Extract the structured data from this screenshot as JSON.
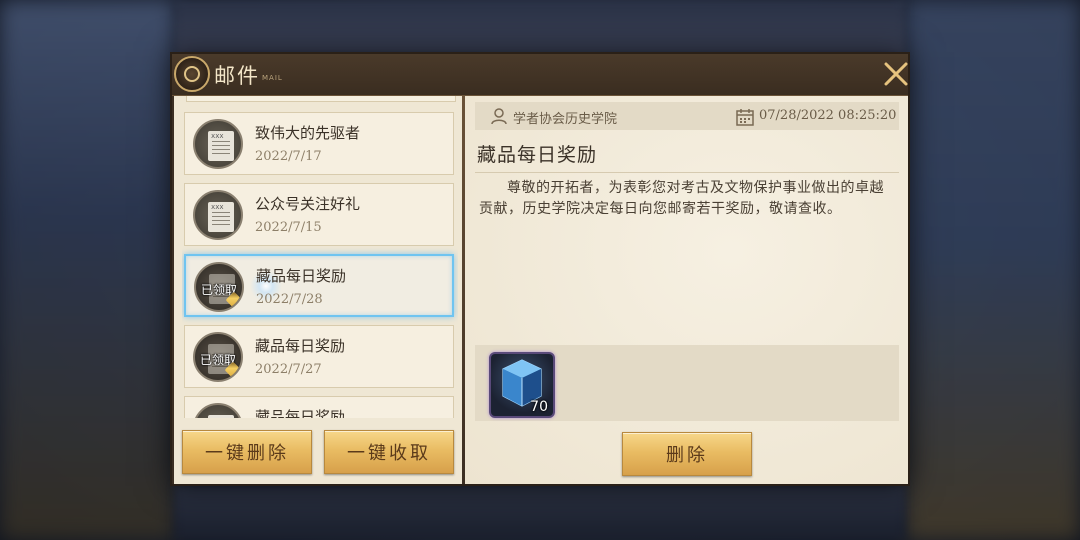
{
  "header": {
    "title": "邮件",
    "subtitle": "MAIL"
  },
  "mail_list": [
    {
      "title": "致伟大的先驱者",
      "date": "2022/7/17",
      "status": "unread-read",
      "icon": "letter-icon"
    },
    {
      "title": "公众号关注好礼",
      "date": "2022/7/15",
      "status": "read",
      "icon": "letter-icon"
    },
    {
      "title": "藏品每日奖励",
      "date": "2022/7/28",
      "status": "claimed",
      "claimed_label": "已领取",
      "selected": true,
      "icon": "letter-icon"
    },
    {
      "title": "藏品每日奖励",
      "date": "2022/7/27",
      "status": "claimed",
      "claimed_label": "已领取",
      "icon": "letter-icon"
    },
    {
      "title": "藏品每日奖励",
      "date": "",
      "status": "partial",
      "icon": "letter-icon"
    }
  ],
  "left_buttons": {
    "delete_all": "一键删除",
    "claim_all": "一键收取"
  },
  "detail": {
    "sender": "学者协会历史学院",
    "timestamp": "07/28/2022 08:25:20",
    "title": "藏品每日奖励",
    "body": "尊敬的开拓者，为表彰您对考古及文物保护事业做出的卓越贡献，历史学院决定每日向您邮寄若干奖励，敬请查收。",
    "attachments": [
      {
        "icon": "blue-crystal-cube-icon",
        "count": "70"
      }
    ],
    "delete_label": "删除"
  },
  "colors": {
    "selected_border": "#6fc4f0",
    "button_gold": "#e9bc63",
    "parchment": "#efe7d4"
  }
}
